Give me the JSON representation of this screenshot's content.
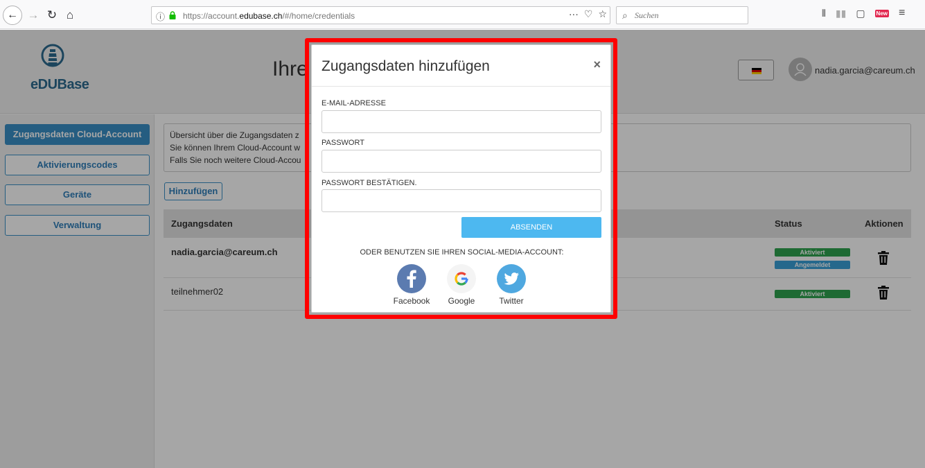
{
  "browser": {
    "url_prefix": "https://account.",
    "url_domain": "edubase.ch",
    "url_suffix": "/#/home/credentials",
    "search_placeholder": "Suchen",
    "new_badge": "New"
  },
  "header": {
    "logo_text": "eDUBase",
    "title": "Ihre",
    "user_email": "nadia.garcia@careum.ch"
  },
  "sidebar": {
    "items": [
      {
        "label": "Zugangsdaten Cloud-Account",
        "active": true
      },
      {
        "label": "Aktivierungscodes",
        "active": false
      },
      {
        "label": "Geräte",
        "active": false
      },
      {
        "label": "Verwaltung",
        "active": false
      }
    ]
  },
  "main": {
    "info_lines": [
      "Übersicht über die Zugangsdaten z",
      "Sie können Ihrem Cloud-Account w",
      "Falls Sie noch weitere Cloud-Accou"
    ],
    "add_label": "Hinzufügen",
    "table": {
      "headers": {
        "credentials": "Zugangsdaten",
        "status": "Status",
        "actions": "Aktionen"
      },
      "rows": [
        {
          "name": "nadia.garcia@careum.ch",
          "statuses": [
            "Aktiviert",
            "Angemeldet"
          ]
        },
        {
          "name": "teilnehmer02",
          "statuses": [
            "Aktiviert"
          ]
        }
      ]
    }
  },
  "modal": {
    "title": "Zugangsdaten hinzufügen",
    "close": "×",
    "email_label": "E-MAIL-ADRESSE",
    "email_value": "",
    "password_label": "PASSWORT",
    "password_value": "",
    "confirm_label": "PASSWORT BESTÄTIGEN.",
    "confirm_value": "",
    "submit_label": "ABSENDEN",
    "social_text": "ODER BENUTZEN SIE IHREN SOCIAL-MEDIA-ACCOUNT:",
    "social": [
      {
        "label": "Facebook",
        "icon": "facebook-icon"
      },
      {
        "label": "Google",
        "icon": "google-icon"
      },
      {
        "label": "Twitter",
        "icon": "twitter-icon"
      }
    ]
  },
  "colors": {
    "accent": "#3a8fc6",
    "submit": "#4db8f0",
    "highlight": "#ff0000",
    "status_active": "#2ea44f",
    "status_logged_in": "#3aa0d8"
  }
}
